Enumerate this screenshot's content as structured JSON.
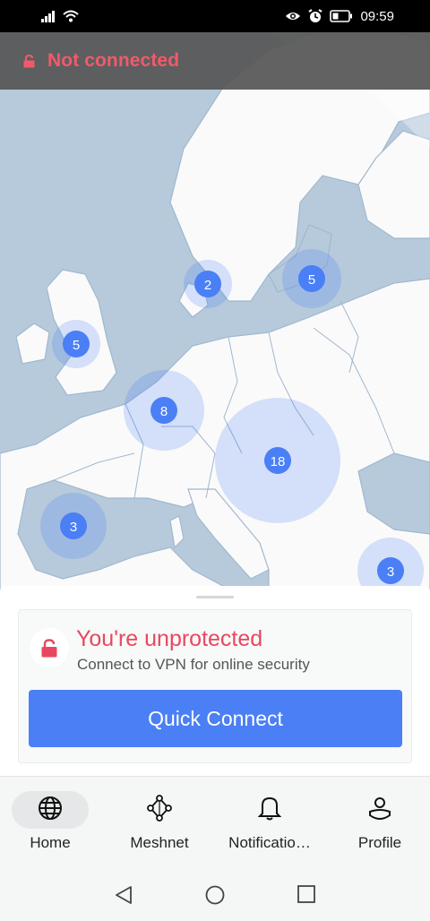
{
  "status_bar": {
    "time": "09:59",
    "icons": [
      "signal-icon",
      "wifi-icon",
      "eye-icon",
      "alarm-icon",
      "battery-icon"
    ]
  },
  "connection": {
    "status_text": "Not connected",
    "status_color": "#f05a6a"
  },
  "map": {
    "clusters": [
      {
        "label": "2",
        "country": "Denmark"
      },
      {
        "label": "5",
        "country": "Latvia"
      },
      {
        "label": "5",
        "country": "United Kingdom"
      },
      {
        "label": "8",
        "country": "Belgium"
      },
      {
        "label": "18",
        "country": "Central Europe"
      },
      {
        "label": "3",
        "country": "Spain"
      },
      {
        "label": "3",
        "country": "Turkey"
      }
    ]
  },
  "card": {
    "title": "You're unprotected",
    "subtitle": "Connect to VPN for online security",
    "button_label": "Quick Connect"
  },
  "nav": {
    "items": [
      {
        "label": "Home",
        "icon": "globe-icon",
        "active": true
      },
      {
        "label": "Meshnet",
        "icon": "meshnet-icon",
        "active": false
      },
      {
        "label": "Notificatio…",
        "icon": "bell-icon",
        "active": false
      },
      {
        "label": "Profile",
        "icon": "profile-icon",
        "active": false
      }
    ]
  },
  "colors": {
    "accent": "#4a7ff5",
    "warning": "#e8485f",
    "map_sea": "#b7cadb",
    "map_land": "#fbfafa",
    "cluster": "#4a7ff5"
  }
}
